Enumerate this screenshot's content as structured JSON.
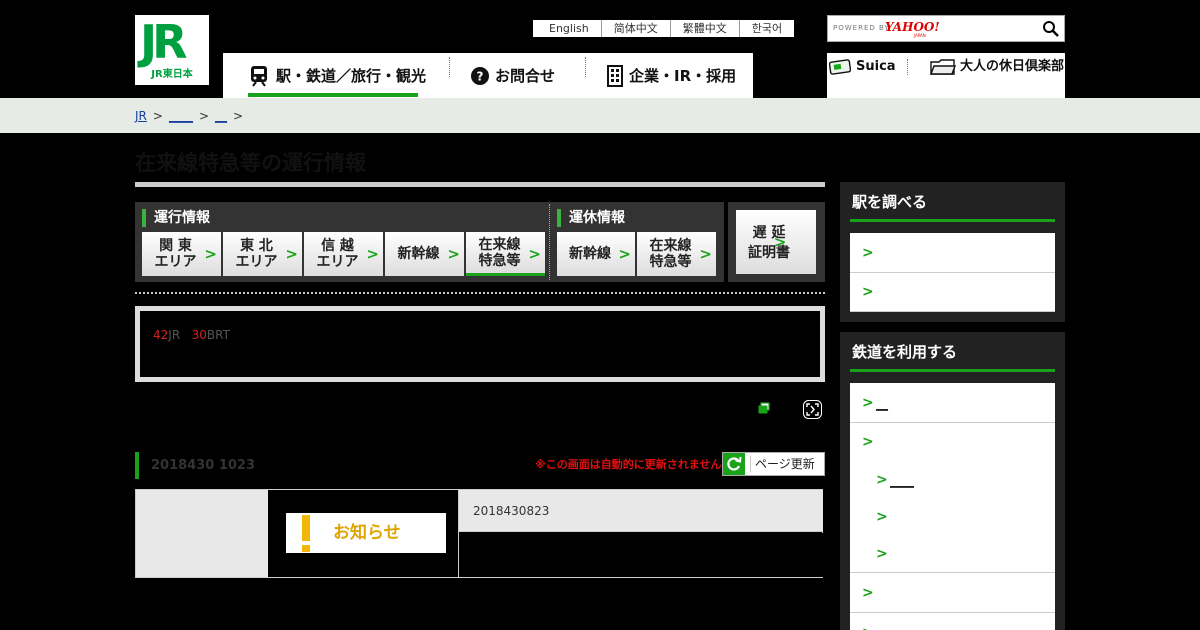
{
  "logo": {
    "main": "JR",
    "sub": "JR東日本"
  },
  "languages": [
    "English",
    "简体中文",
    "繁體中文",
    "한국어"
  ],
  "search": {
    "powered_by": "POWERED BY",
    "provider": "YAHOO!",
    "provider_sub": "JAPAN"
  },
  "gnav": {
    "item1": "駅・鉄道／旅行・観光",
    "item2": "お問合せ",
    "item3": "企業・IR・採用"
  },
  "subnav": {
    "suica": "Suica",
    "club": "大人の休日倶楽部"
  },
  "breadcrumb": {
    "home": "JR",
    "level2": "____",
    "level3": "__",
    "sep": ">"
  },
  "page_title": "在来線特急等の運行情報",
  "tabs": {
    "unko_label": "運行情報",
    "unkyu_label": "運休情報",
    "kanto": "関 東\nエリア",
    "tohoku": "東 北\nエリア",
    "shinetsu": "信 越\nエリア",
    "shinkansen": "新幹線",
    "zairai": "在来線\n特急等",
    "unkyu_shinkansen": "新幹線",
    "unkyu_zairai": "在来線\n特急等",
    "delay_cert": "遅 延\n証明書"
  },
  "summary": {
    "count_jr": "42",
    "label_jr": "JR",
    "count_brt": "30",
    "label_brt": "BRT"
  },
  "update": {
    "time": "2018430 1023",
    "notice": "※この画面は自動的に更新されません",
    "refresh_label": "ページ更新"
  },
  "info": {
    "badge": "お知らせ",
    "date": "2018430823"
  },
  "sidebar": {
    "station_head": "駅を調べる",
    "rail_head": "鉄道を利用する",
    "rail_items": [
      "__",
      "",
      "____",
      "",
      "",
      "",
      ""
    ]
  },
  "colors": {
    "accent_green": "#1aa31a",
    "jr_green": "#00a040",
    "alert_red": "#e01010",
    "notice_yellow": "#f2b705"
  }
}
